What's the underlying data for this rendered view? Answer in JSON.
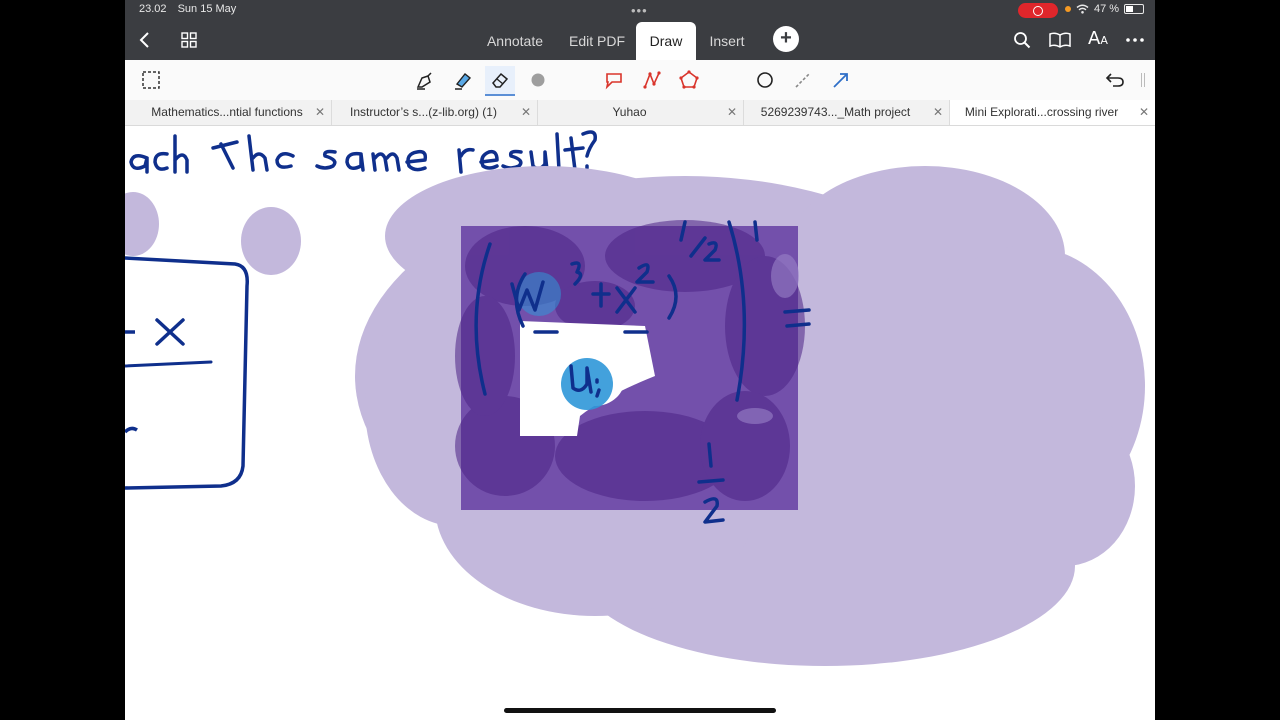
{
  "status_bar": {
    "time": "23.02",
    "date": "Sun 15 May",
    "more": "•••",
    "battery_percent": "47 %"
  },
  "toolbar": {
    "menu_tabs": [
      "Annotate",
      "Edit PDF",
      "Draw",
      "Insert"
    ],
    "active_tab": "Draw",
    "plus": "+",
    "aa_big": "A",
    "aa_small": "A"
  },
  "drawing_tools": [
    {
      "name": "pen",
      "selected": false
    },
    {
      "name": "highlighter",
      "selected": false
    },
    {
      "name": "eraser",
      "selected": true
    },
    {
      "name": "color",
      "selected": false
    },
    {
      "name": "lasso",
      "selected": false
    },
    {
      "name": "shape-line",
      "selected": false
    },
    {
      "name": "shape-polygon",
      "selected": false
    },
    {
      "name": "circle",
      "selected": false
    },
    {
      "name": "dashed-line",
      "selected": false
    },
    {
      "name": "arrow",
      "selected": false
    }
  ],
  "doc_tabs": [
    {
      "label": "Mathematics...ntial functions"
    },
    {
      "label": "Instructor’s s...(z-lib.org) (1)"
    },
    {
      "label": "Yuhao"
    },
    {
      "label": "5269239743..._Math project"
    },
    {
      "label": "Mini Explorati...crossing river",
      "active": true
    }
  ],
  "colors": {
    "ink": "#0f2f8c",
    "highlight_light": "#c3b8dc",
    "highlight_dark": "#5b3296",
    "blue_dot": "#2f97d8",
    "toolbar_bg": "#3b3d41",
    "accent_red": "#d9342b",
    "accent_blue": "#2f6fc7"
  }
}
